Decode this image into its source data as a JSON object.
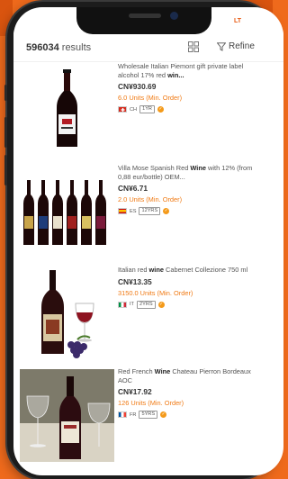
{
  "status": {
    "right_text": "LT"
  },
  "header": {
    "result_count": "596034",
    "results_label": "results",
    "refine_label": "Refine"
  },
  "products": [
    {
      "title_pre": "Wholesale Italian Piemont gift private label alcohol 17% red ",
      "title_bold": "win...",
      "price": "CN¥930.69",
      "moq": "6.0 Units (Min. Order)",
      "country": "CH",
      "years": "1YR",
      "image": "single-red-wine-bottle-with-white-label"
    },
    {
      "title_pre": "Villa Mose Spanish Red ",
      "title_bold": "Wine",
      "title_post": " with 12% (from 0,88 eur/bottle) OEM...",
      "price": "CN¥6.71",
      "moq": "2.0 Units (Min. Order)",
      "country": "ES",
      "years": "12YRS",
      "image": "row-of-six-wine-bottles"
    },
    {
      "title_pre": "Italian red ",
      "title_bold": "wine",
      "title_post": " Cabernet Collezione 750 ml",
      "price": "CN¥13.35",
      "moq": "3150.0 Units (Min. Order)",
      "country": "IT",
      "years": "2YRS",
      "image": "wine-bottle-with-glass-and-grapes"
    },
    {
      "title_pre": "Red French ",
      "title_bold": "Wine",
      "title_post": " Chateau Pierron Bordeaux AOC",
      "price": "CN¥17.92",
      "moq": "126 Units (Min. Order)",
      "country": "FR",
      "years": "5YRS",
      "image": "wine-bottle-on-table-with-glasses"
    }
  ],
  "colors": {
    "accent": "#f07a14",
    "background": "#ef6a1c"
  }
}
